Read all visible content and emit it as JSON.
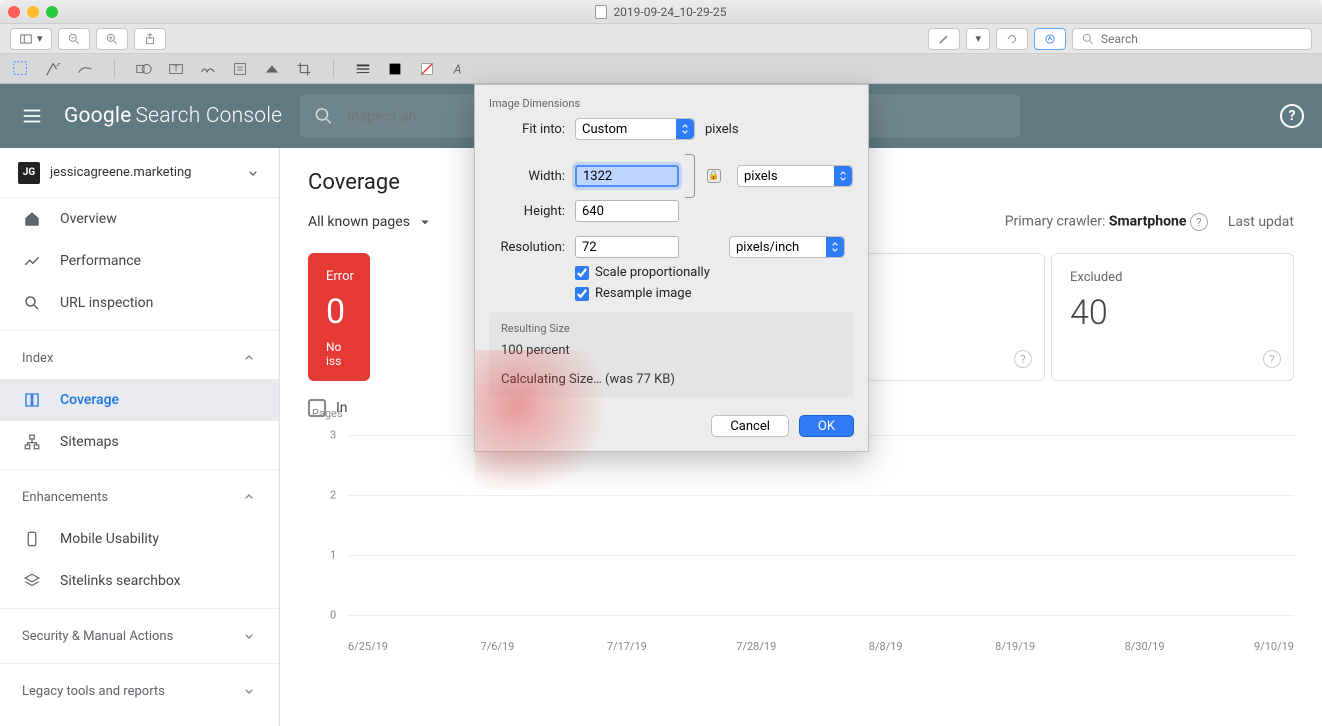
{
  "titlebar": {
    "filename": "2019-09-24_10-29-25"
  },
  "mac_search": {
    "placeholder": "Search"
  },
  "gsc": {
    "logo_google": "Google",
    "logo_sc": "Search Console",
    "search_placeholder": "Inspect an",
    "help": "?"
  },
  "property": {
    "icon": "JG",
    "name": "jessicagreene.marketing"
  },
  "nav": {
    "overview": "Overview",
    "performance": "Performance",
    "url_inspection": "URL inspection",
    "index_section": "Index",
    "coverage": "Coverage",
    "sitemaps": "Sitemaps",
    "enhancements_section": "Enhancements",
    "mobile": "Mobile Usability",
    "sitelinks": "Sitelinks searchbox",
    "security_section": "Security & Manual Actions",
    "legacy_section": "Legacy tools and reports"
  },
  "page": {
    "title": "Coverage",
    "filter": "All known pages",
    "primary_crawler_label": "Primary crawler:",
    "primary_crawler_value": "Smartphone",
    "last_updated": "Last updat"
  },
  "cards": {
    "error": {
      "label": "Error",
      "value": "0",
      "issues": "No iss"
    },
    "excluded": {
      "label": "Excluded",
      "value": "40"
    },
    "info_glyph": "?"
  },
  "impressions_label": "In",
  "chart_data": {
    "type": "line",
    "title": "",
    "ylabel": "Pages",
    "xlabel": "",
    "y_ticks": [
      0,
      1,
      2,
      3
    ],
    "ylim": [
      0,
      3
    ],
    "x_ticks": [
      "6/25/19",
      "7/6/19",
      "7/17/19",
      "7/28/19",
      "8/8/19",
      "8/19/19",
      "8/30/19",
      "9/10/19"
    ],
    "series": []
  },
  "dialog": {
    "section1": "Image Dimensions",
    "fit_label": "Fit into:",
    "fit_value": "Custom",
    "fit_unit": "pixels",
    "width_label": "Width:",
    "width_value": "1322",
    "height_label": "Height:",
    "height_value": "640",
    "wh_unit": "pixels",
    "res_label": "Resolution:",
    "res_value": "72",
    "res_unit": "pixels/inch",
    "scale": "Scale proportionally",
    "resample": "Resample image",
    "resulting_label": "Resulting Size",
    "resulting_pct": "100 percent",
    "resulting_calc": "Calculating Size… (was 77 KB)",
    "cancel": "Cancel",
    "ok": "OK"
  }
}
